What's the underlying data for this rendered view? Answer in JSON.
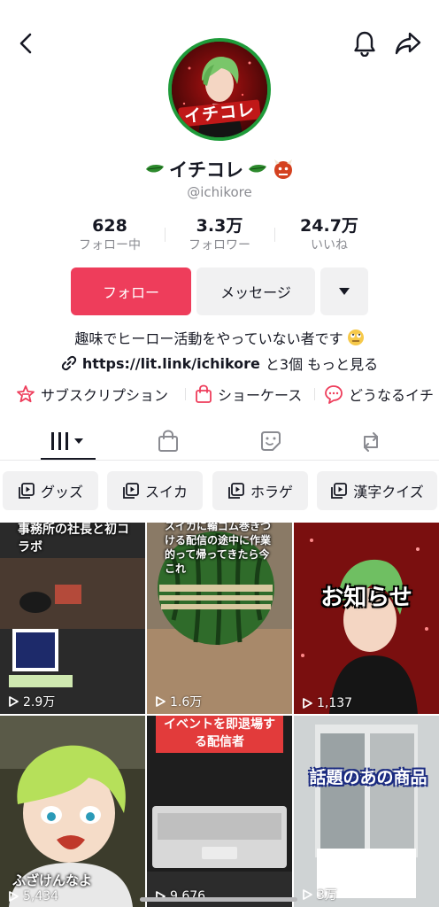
{
  "header": {
    "back_icon": "chevron-left-icon",
    "bell_icon": "bell-icon",
    "share_icon": "share-arrow-icon"
  },
  "profile": {
    "avatar_text": "イチコレ",
    "nickname": "イチコレ",
    "username": "@ichikore"
  },
  "stats": [
    {
      "value": "628",
      "label": "フォロー中"
    },
    {
      "value": "3.3万",
      "label": "フォロワー"
    },
    {
      "value": "24.7万",
      "label": "いいね"
    }
  ],
  "buttons": {
    "follow": "フォロー",
    "message": "メッセージ"
  },
  "bio": {
    "text": "趣味でヒーロー活動をやっていない者です",
    "link": "https://lit.link/ichikore",
    "link_extra": "と3個 もっと見る"
  },
  "features": [
    {
      "icon": "subscription-icon",
      "label": "サブスクリプション"
    },
    {
      "icon": "shopping-bag-icon",
      "label": "ショーケース"
    },
    {
      "icon": "question-bubble-icon",
      "label": "どうなるイチ"
    }
  ],
  "tabs": [
    {
      "icon": "grid-icon",
      "active": true
    },
    {
      "icon": "bag-icon",
      "active": false
    },
    {
      "icon": "sticker-icon",
      "active": false
    },
    {
      "icon": "repost-icon",
      "active": false
    }
  ],
  "playlists": [
    "グッズ",
    "スイカ",
    "ホラゲ",
    "漢字クイズ"
  ],
  "videos": [
    {
      "caption": "事務所の社長と初コラボ",
      "views": "2.9万"
    },
    {
      "caption": "スイカに輪ゴム巻きつける配信の途中に作業的って帰ってきたら今これ",
      "views": "1.6万"
    },
    {
      "caption": "お知らせ",
      "views": "1,137"
    },
    {
      "caption": "ふざけんなよ",
      "views": "5,434"
    },
    {
      "caption": "イベントを即退場する配信者",
      "views": "9,676"
    },
    {
      "caption": "話題のあの商品",
      "views": "3万"
    }
  ],
  "colors": {
    "accent": "#ee3d5b",
    "chip_bg": "#f1f1f2",
    "text": "#161823",
    "muted": "#8a8b91"
  }
}
